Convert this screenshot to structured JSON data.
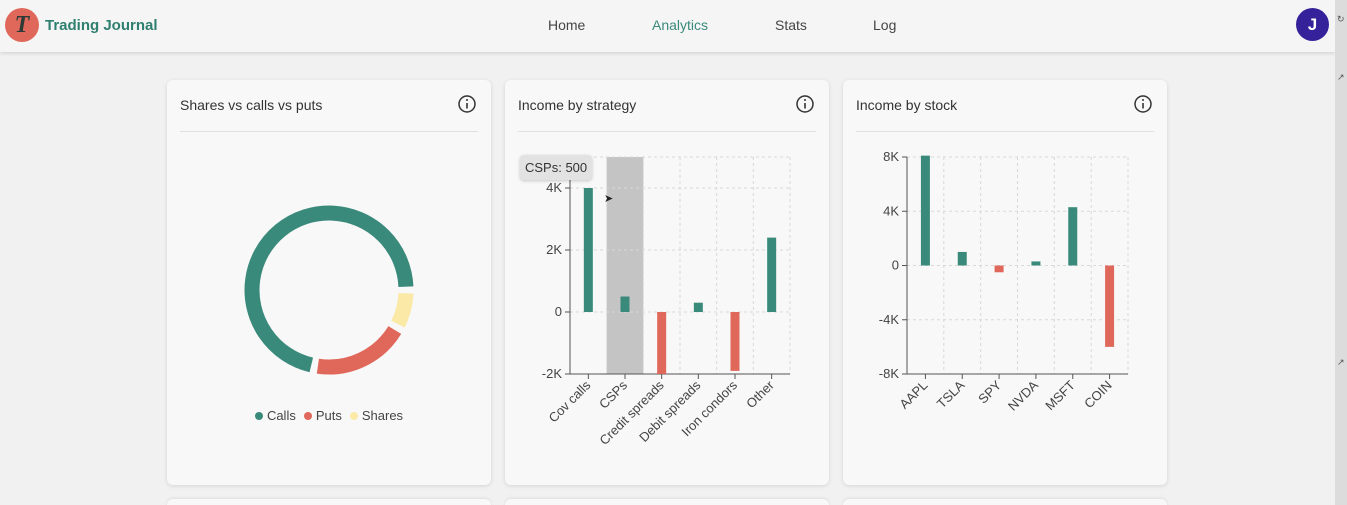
{
  "app": {
    "title": "Trading Journal",
    "logo_letter": "T"
  },
  "nav": [
    {
      "label": "Home",
      "active": false
    },
    {
      "label": "Analytics",
      "active": true
    },
    {
      "label": "Stats",
      "active": false
    },
    {
      "label": "Log",
      "active": false
    }
  ],
  "user": {
    "initial": "J"
  },
  "colors": {
    "teal": "#3a8a7b",
    "red": "#e0685b",
    "yellow": "#fbe9a8",
    "avatar": "#35229a"
  },
  "cards": {
    "mix": {
      "title": "Shares vs calls vs puts",
      "info_icon": "info-circle-icon"
    },
    "strategy": {
      "title": "Income by strategy",
      "info_icon": "info-circle-icon",
      "tooltip": "CSPs: 500"
    },
    "stock": {
      "title": "Income by stock",
      "info_icon": "info-circle-icon"
    }
  },
  "chart_data": [
    {
      "type": "pie",
      "variant": "donut",
      "categories": [
        "Calls",
        "Puts",
        "Shares"
      ],
      "values": [
        72,
        20,
        8
      ],
      "colors": [
        "#3a8a7b",
        "#e0685b",
        "#fbe9a8"
      ],
      "legend": "bottom"
    },
    {
      "type": "bar",
      "categories": [
        "Cov calls",
        "CSPs",
        "Credit spreads",
        "Debit spreads",
        "Iron condors",
        "Other"
      ],
      "values": [
        4000,
        500,
        -2000,
        300,
        -1900,
        2400
      ],
      "ylim": [
        -2000,
        5000
      ],
      "yticks": [
        -2000,
        0,
        2000,
        4000
      ],
      "ytick_labels": [
        "-2K",
        "0",
        "2K",
        "4K"
      ],
      "highlighted": "CSPs",
      "grid": true
    },
    {
      "type": "bar",
      "categories": [
        "AAPL",
        "TSLA",
        "SPY",
        "NVDA",
        "MSFT",
        "COIN"
      ],
      "values": [
        8100,
        1000,
        -500,
        300,
        4300,
        -6000
      ],
      "ylim": [
        -8000,
        8000
      ],
      "yticks": [
        -8000,
        -4000,
        0,
        4000,
        8000
      ],
      "ytick_labels": [
        "-8K",
        "-4K",
        "0",
        "4K",
        "8K"
      ],
      "grid": true
    }
  ]
}
